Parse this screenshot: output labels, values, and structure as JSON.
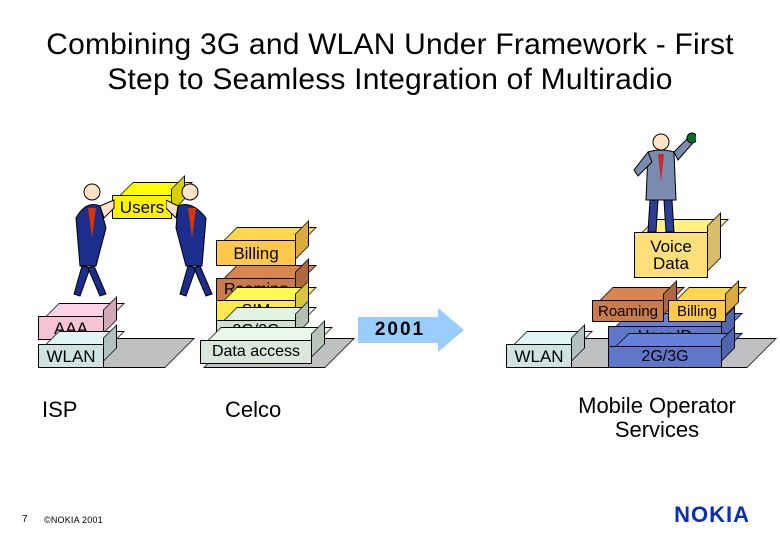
{
  "title_line1": "Combining 3G and WLAN Under Framework - First",
  "title_line2": "Step to Seamless Integration of Multiradio",
  "left": {
    "users": "Users",
    "aaa": "AAA",
    "wlan": "WLAN",
    "billing": "Billing",
    "roaming": "Roaming",
    "sim": "SIM",
    "g23": "2G/3G",
    "data_access": "Data access",
    "isp": "ISP",
    "celco": "Celco"
  },
  "center": {
    "arrow_label": "2001"
  },
  "right": {
    "voice_data": "Voice\nData",
    "roaming": "Roaming",
    "billing": "Billing",
    "user_id": "User ID",
    "g23": "2G/3G",
    "wlan": "WLAN",
    "mobile_op": "Mobile Operator\nServices"
  },
  "footer": {
    "page": "7",
    "copyright": "©NOKIA 2001",
    "logo": "NOKIA"
  },
  "colors": {
    "arrow": "#99CCFF",
    "logo": "#0a2fb5",
    "users": "#fff200",
    "billing": "#ffc84a",
    "roaming": "#c97b4a",
    "aaa": "#f6c3d6",
    "wlan": "#cfe3e3",
    "blue": "#5e77c9"
  }
}
